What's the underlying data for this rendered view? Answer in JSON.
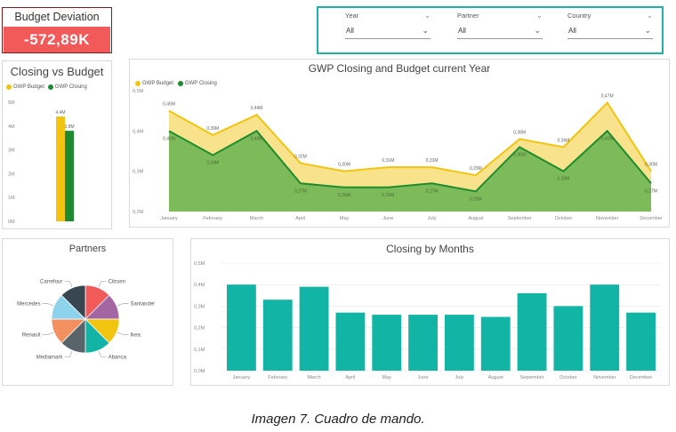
{
  "kpi": {
    "label": "Budget Deviation",
    "value": "-572,89K"
  },
  "filters": [
    {
      "name": "Year",
      "value": "All"
    },
    {
      "name": "Partner",
      "value": "All"
    },
    {
      "name": "Country",
      "value": "All"
    }
  ],
  "colors": {
    "budget": "#f2c40f",
    "closing": "#1e8c2e",
    "teal": "#12b5a5",
    "kpi": "#f25a5a"
  },
  "chart_data": [
    {
      "type": "bar",
      "title": "Closing vs Budget",
      "series": [
        {
          "name": "GWP Budget",
          "values": [
            4.4
          ]
        },
        {
          "name": "GWP Closing",
          "values": [
            3.8
          ]
        }
      ],
      "data_labels": [
        "4,4M",
        "3,8M"
      ],
      "y_ticks": [
        "0M",
        "1M",
        "2M",
        "3M",
        "4M",
        "5M"
      ],
      "ylim": [
        0,
        5
      ]
    },
    {
      "type": "area",
      "title": "GWP Closing and Budget current Year",
      "categories": [
        "January",
        "February",
        "March",
        "April",
        "May",
        "June",
        "July",
        "August",
        "September",
        "October",
        "November",
        "December"
      ],
      "series": [
        {
          "name": "GWP Budget",
          "values": [
            0.45,
            0.39,
            0.44,
            0.32,
            0.3,
            0.31,
            0.31,
            0.29,
            0.38,
            0.36,
            0.47,
            0.3
          ],
          "labels": [
            "0,45M",
            "0,39M",
            "0,44M",
            "0,32M",
            "0,30M",
            "0,31M",
            "0,31M",
            "0,29M",
            "0,38M",
            "0,36M",
            "0,47M",
            "0,30M"
          ]
        },
        {
          "name": "GWP Closing",
          "values": [
            0.4,
            0.34,
            0.4,
            0.27,
            0.26,
            0.26,
            0.27,
            0.25,
            0.36,
            0.3,
            0.4,
            0.27
          ],
          "labels": [
            "0,40M",
            "0,34M",
            "0,40M",
            "0,27M",
            "0,26M",
            "0,26M",
            "0,27M",
            "0,25M",
            "0,36M",
            "0,30M",
            "0,40M",
            "0,27M"
          ]
        }
      ],
      "y_ticks": [
        "0,2M",
        "0,3M",
        "0,4M",
        "0,5M"
      ],
      "ylim": [
        0.2,
        0.5
      ]
    },
    {
      "type": "pie",
      "title": "Partners",
      "slices": [
        {
          "label": "Citroen",
          "value": 12.5,
          "color": "#f25a5a"
        },
        {
          "label": "Santander",
          "value": 12.5,
          "color": "#a466a2"
        },
        {
          "label": "Ikea",
          "value": 12.5,
          "color": "#f2c40f"
        },
        {
          "label": "Abanca",
          "value": 12.5,
          "color": "#12b5a5"
        },
        {
          "label": "Mediamark",
          "value": 12.5,
          "color": "#58636a"
        },
        {
          "label": "Renault",
          "value": 12.5,
          "color": "#f39060"
        },
        {
          "label": "Mercedes",
          "value": 12.5,
          "color": "#8ed3ec"
        },
        {
          "label": "Carrefour",
          "value": 12.5,
          "color": "#374651"
        }
      ]
    },
    {
      "type": "bar",
      "title": "Closing by Months",
      "categories": [
        "January",
        "February",
        "March",
        "April",
        "May",
        "June",
        "July",
        "August",
        "September",
        "October",
        "November",
        "December"
      ],
      "values": [
        0.4,
        0.33,
        0.39,
        0.27,
        0.26,
        0.26,
        0.26,
        0.25,
        0.36,
        0.3,
        0.4,
        0.27
      ],
      "y_ticks": [
        "0,0M",
        "0,1M",
        "0,2M",
        "0,3M",
        "0,4M",
        "0,5M"
      ],
      "ylim": [
        0,
        0.5
      ]
    }
  ],
  "caption": "Imagen 7. Cuadro de mando."
}
